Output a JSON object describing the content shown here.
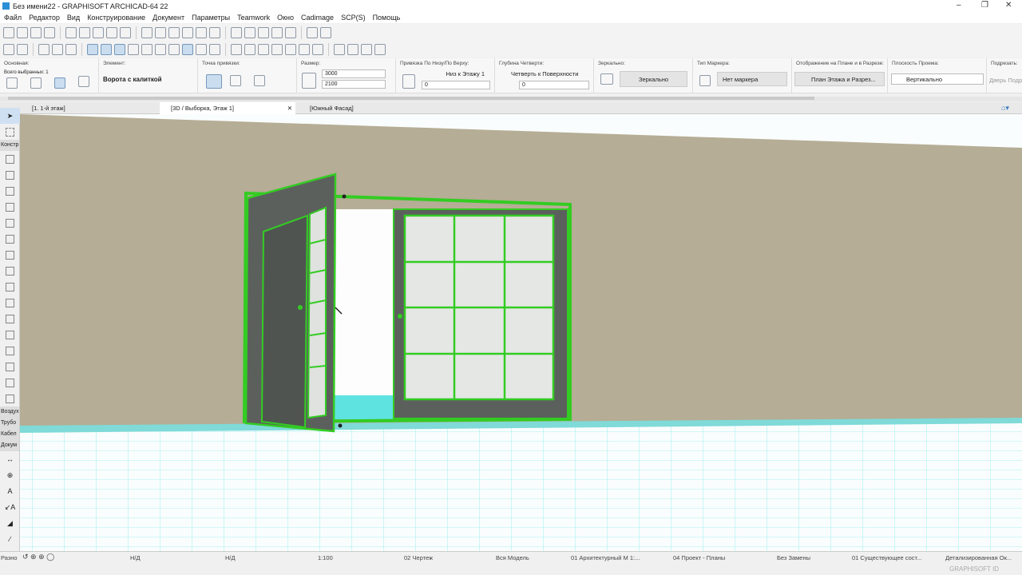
{
  "window": {
    "title": "Без имени22 - GRAPHISOFT ARCHICAD-64 22"
  },
  "menu": [
    "Файл",
    "Редактор",
    "Вид",
    "Конструирование",
    "Документ",
    "Параметры",
    "Teamwork",
    "Окно",
    "Cadimage",
    "SCP(S)",
    "Помощь"
  ],
  "info_box": {
    "main": {
      "label": "Основная:",
      "selected": "Всего выбранных: 1"
    },
    "element": {
      "label": "Элемент:",
      "value": "Ворота с калиткой"
    },
    "anchor": {
      "label": "Точка привязки:"
    },
    "size": {
      "label": "Размер:",
      "width": "3000",
      "height": "2100"
    },
    "anchoring": {
      "label": "Привязка По Низу/По Верху:",
      "value": "Низ к Этажу 1",
      "offset": "0"
    },
    "reveal": {
      "label": "Глубина Четверти:",
      "value": "Четверть к Поверхности",
      "offset": "0"
    },
    "mirror": {
      "label": "Зеркально:",
      "button": "Зеркально"
    },
    "marker": {
      "label": "Тип Маркера:",
      "value": "Нет маркера"
    },
    "display": {
      "label": "Отображение на Плане и в Разрезе:",
      "value": "План Этажа и Разрез..."
    },
    "plane": {
      "label": "Плоскость Проема:",
      "value": "Вертикально"
    },
    "label": {
      "label": "Подрезать:",
      "value": "Дверь Подр"
    }
  },
  "tabs": [
    {
      "label": "[1. 1-й этаж]"
    },
    {
      "label": "[3D / Выборка, Этаж 1]"
    },
    {
      "label": "[Южный Фасад]"
    }
  ],
  "toolbox": {
    "categories": [
      "Констр",
      "Воздух",
      "Трубо",
      "Кабел",
      "Докум",
      "Разно"
    ]
  },
  "status": {
    "nd1": "Н/Д",
    "nd2": "Н/Д",
    "scale": "1:100",
    "layer": "02 Чертеж",
    "model": "Вся Модель",
    "pen": "01 Архитектурный М 1:...",
    "view": "04 Проект - Планы",
    "override": "Без Замены",
    "renovation": "01 Существующее сост...",
    "detail": "Детализированная Ок..."
  },
  "footer": {
    "brand": "GRAPHISOFT ID"
  },
  "colors": {
    "selection": "#33cc22",
    "wall": "#b5ad95",
    "grid": "#33dddd"
  }
}
